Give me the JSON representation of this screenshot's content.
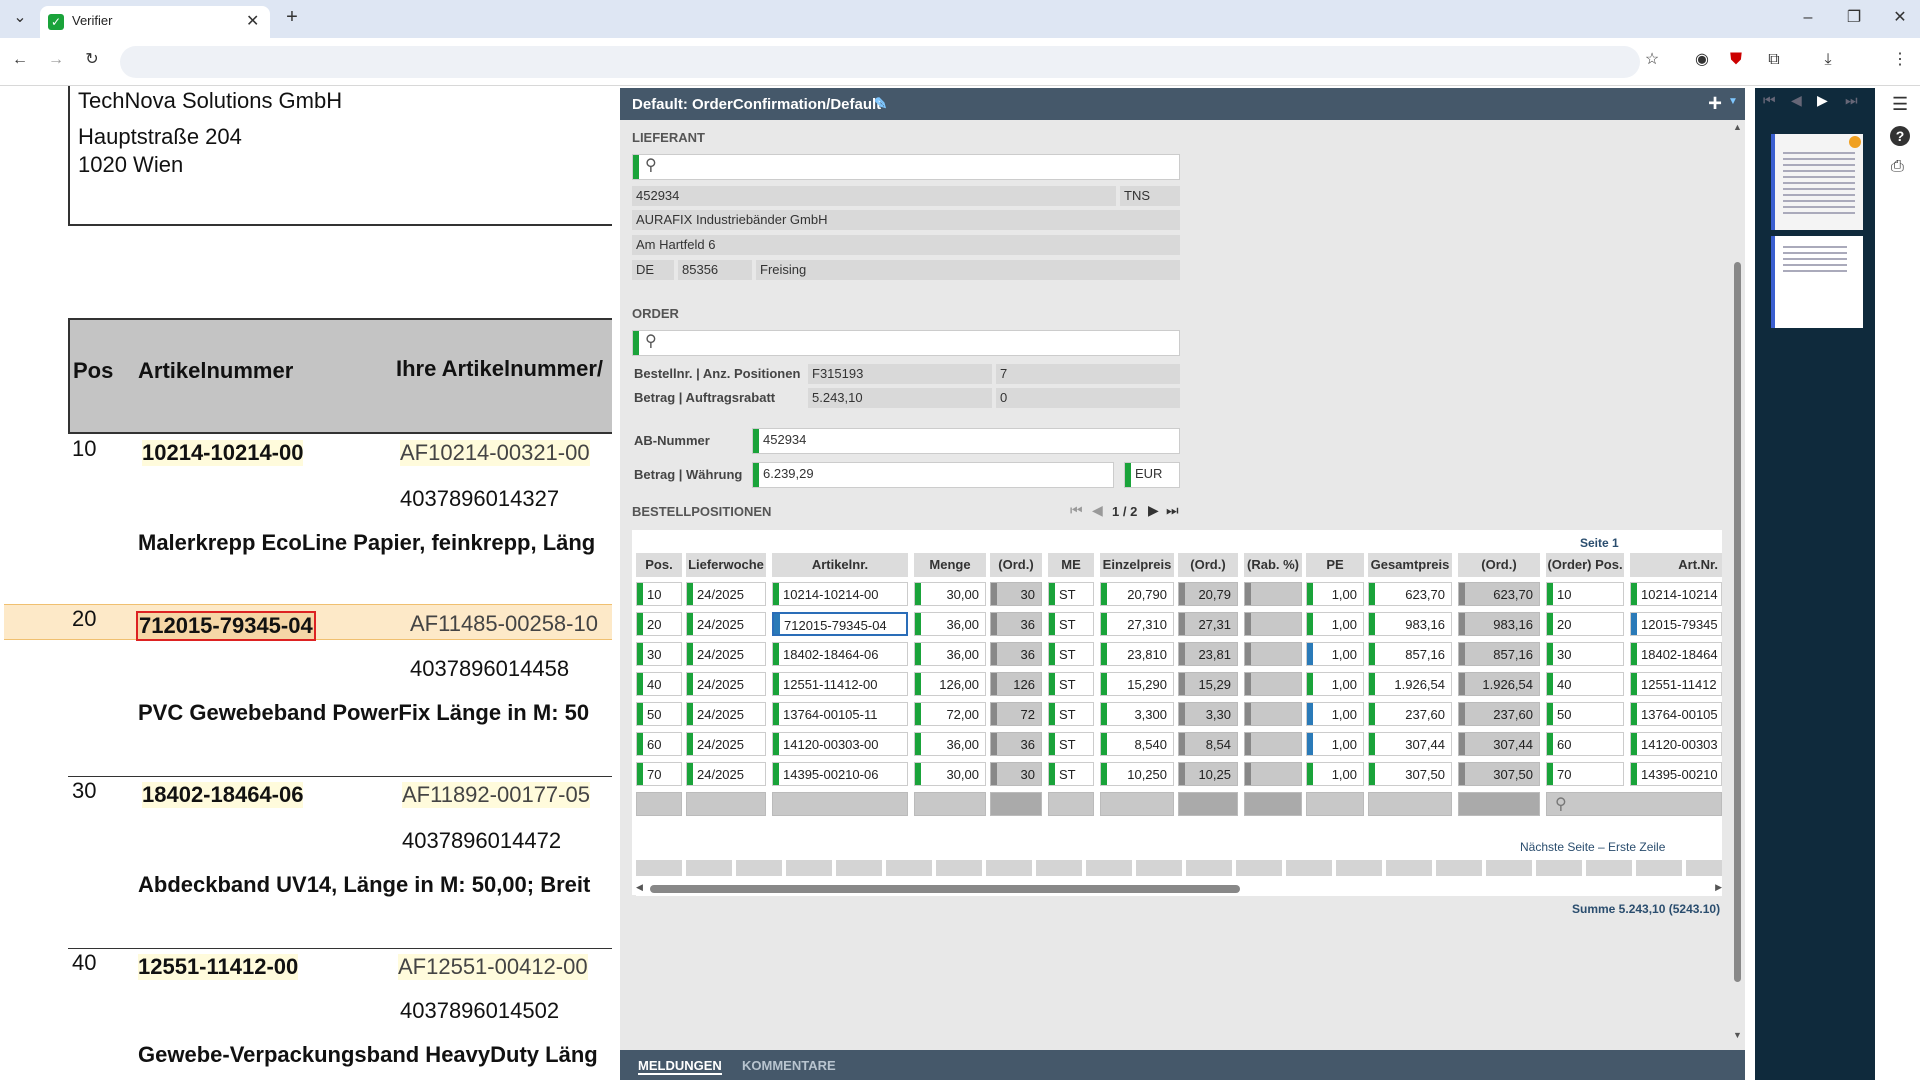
{
  "browser": {
    "tab_title": "Verifier",
    "tab_icon": "check-icon"
  },
  "document": {
    "company": "TechNova Solutions GmbH",
    "street": "Hauptstraße 204",
    "city": "1020 Wien",
    "col_pos": "Pos",
    "col_artnr": "Artikelnummer",
    "col_ihre": "Ihre Artikelnummer/",
    "items": [
      {
        "pos": "10",
        "artnr": "10214-10214-00",
        "ihre": "AF10214-00321-00",
        "ean": "4037896014327",
        "desc": "Malerkrepp EcoLine Papier, feinkrepp, Läng"
      },
      {
        "pos": "20",
        "artnr": "712015-79345-04",
        "ihre": "AF11485-00258-10",
        "ean": "4037896014458",
        "desc": "PVC Gewebeband PowerFix Länge in M: 50"
      },
      {
        "pos": "30",
        "artnr": "18402-18464-06",
        "ihre": "AF11892-00177-05",
        "ean": "4037896014472",
        "desc": "Abdeckband UV14, Länge in M: 50,00; Breit"
      },
      {
        "pos": "40",
        "artnr": "12551-11412-00",
        "ihre": "AF12551-00412-00",
        "ean": "4037896014502",
        "desc": "Gewebe-Verpackungsband HeavyDuty Läng"
      }
    ]
  },
  "verifier": {
    "header_title": "Default: OrderConfirmation/Default",
    "lieferant_label": "LIEFERANT",
    "lieferant": {
      "nr": "452934",
      "code": "TNS",
      "name": "AURAFIX Industriebänder GmbH",
      "street": "Am Hartfeld 6",
      "country": "DE",
      "zip": "85356",
      "city": "Freising"
    },
    "order_label": "ORDER",
    "order": {
      "bestell_label": "Bestellnr. | Anz. Positionen",
      "bestellnr": "F315193",
      "anz": "7",
      "betrag_label": "Betrag | Auftragsrabatt",
      "betrag": "5.243,10",
      "rabatt": "0"
    },
    "ab_label": "AB-Nummer",
    "ab_value": "452934",
    "betrag_w_label": "Betrag | Währung",
    "betrag_w_value": "6.239,29",
    "currency": "EUR",
    "positions_label": "BESTELLPOSITIONEN",
    "pager": "1 / 2",
    "page_label": "Seite 1",
    "columns": [
      "Pos.",
      "Lieferwoche",
      "Artikelnr.",
      "Menge",
      "(Ord.)",
      "ME",
      "Einzelpreis",
      "(Ord.)",
      "(Rab. %)",
      "PE",
      "Gesamtpreis",
      "(Ord.)",
      "(Order) Pos.",
      "Art.Nr."
    ],
    "rows": [
      [
        "10",
        "24/2025",
        "10214-10214-00",
        "30,00",
        "30",
        "ST",
        "20,790",
        "20,79",
        "",
        "1,00",
        "623,70",
        "623,70",
        "10",
        "10214-10214"
      ],
      [
        "20",
        "24/2025",
        "712015-79345-04",
        "36,00",
        "36",
        "ST",
        "27,310",
        "27,31",
        "",
        "1,00",
        "983,16",
        "983,16",
        "20",
        "12015-79345"
      ],
      [
        "30",
        "24/2025",
        "18402-18464-06",
        "36,00",
        "36",
        "ST",
        "23,810",
        "23,81",
        "",
        "1,00",
        "857,16",
        "857,16",
        "30",
        "18402-18464"
      ],
      [
        "40",
        "24/2025",
        "12551-11412-00",
        "126,00",
        "126",
        "ST",
        "15,290",
        "15,29",
        "",
        "1,00",
        "1.926,54",
        "1.926,54",
        "40",
        "12551-11412"
      ],
      [
        "50",
        "24/2025",
        "13764-00105-11",
        "72,00",
        "72",
        "ST",
        "3,300",
        "3,30",
        "",
        "1,00",
        "237,60",
        "237,60",
        "50",
        "13764-00105"
      ],
      [
        "60",
        "24/2025",
        "14120-00303-00",
        "36,00",
        "36",
        "ST",
        "8,540",
        "8,54",
        "",
        "1,00",
        "307,44",
        "307,44",
        "60",
        "14120-00303"
      ],
      [
        "70",
        "24/2025",
        "14395-00210-06",
        "30,00",
        "30",
        "ST",
        "10,250",
        "10,25",
        "",
        "1,00",
        "307,50",
        "307,50",
        "70",
        "14395-00210"
      ]
    ],
    "next_page": "Nächste Seite – Erste Zeile",
    "summe": "Summe 5.243,10 (5243.10)",
    "tab_meldungen": "MELDUNGEN",
    "tab_kommentare": "KOMMENTARE"
  }
}
